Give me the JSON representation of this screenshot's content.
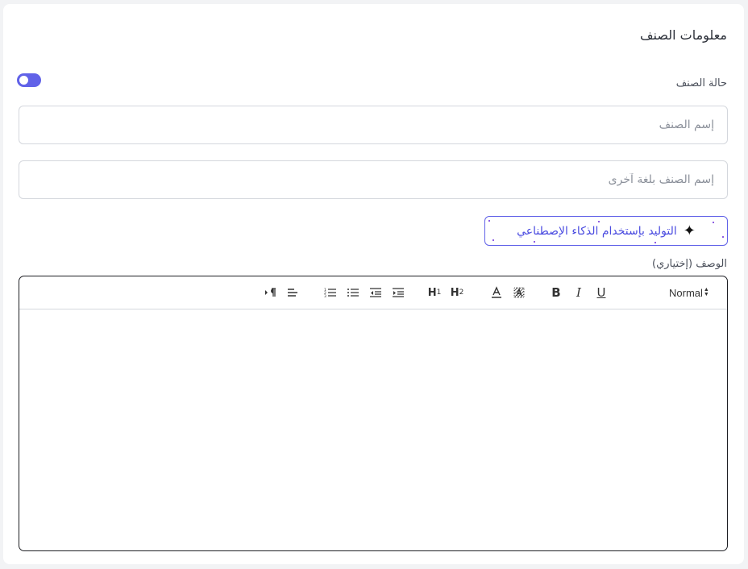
{
  "form": {
    "title": "معلومات الصنف",
    "status_label": "حالة الصنف",
    "status_enabled": true,
    "name_placeholder": "إسم الصنف",
    "name_other_placeholder": "إسم الصنف بلغة آخرى",
    "ai_button_label": "التوليد بإستخدام الذكاء الإصطناعي",
    "description_label": "الوصف (إختياري)"
  },
  "editor": {
    "format_select": "Normal",
    "buttons": {
      "bold": "B",
      "italic": "I",
      "underline": "U",
      "h1": "H",
      "h1_sub": "1",
      "h2": "H",
      "h2_sub": "2"
    },
    "icons": [
      "rtl-direction-icon",
      "align-icon",
      "ordered-list-icon",
      "bullet-list-icon",
      "outdent-icon",
      "indent-icon",
      "text-color-icon",
      "background-color-icon"
    ]
  },
  "colors": {
    "accent": "#6162e8",
    "ai_text": "#4b4ce0"
  }
}
